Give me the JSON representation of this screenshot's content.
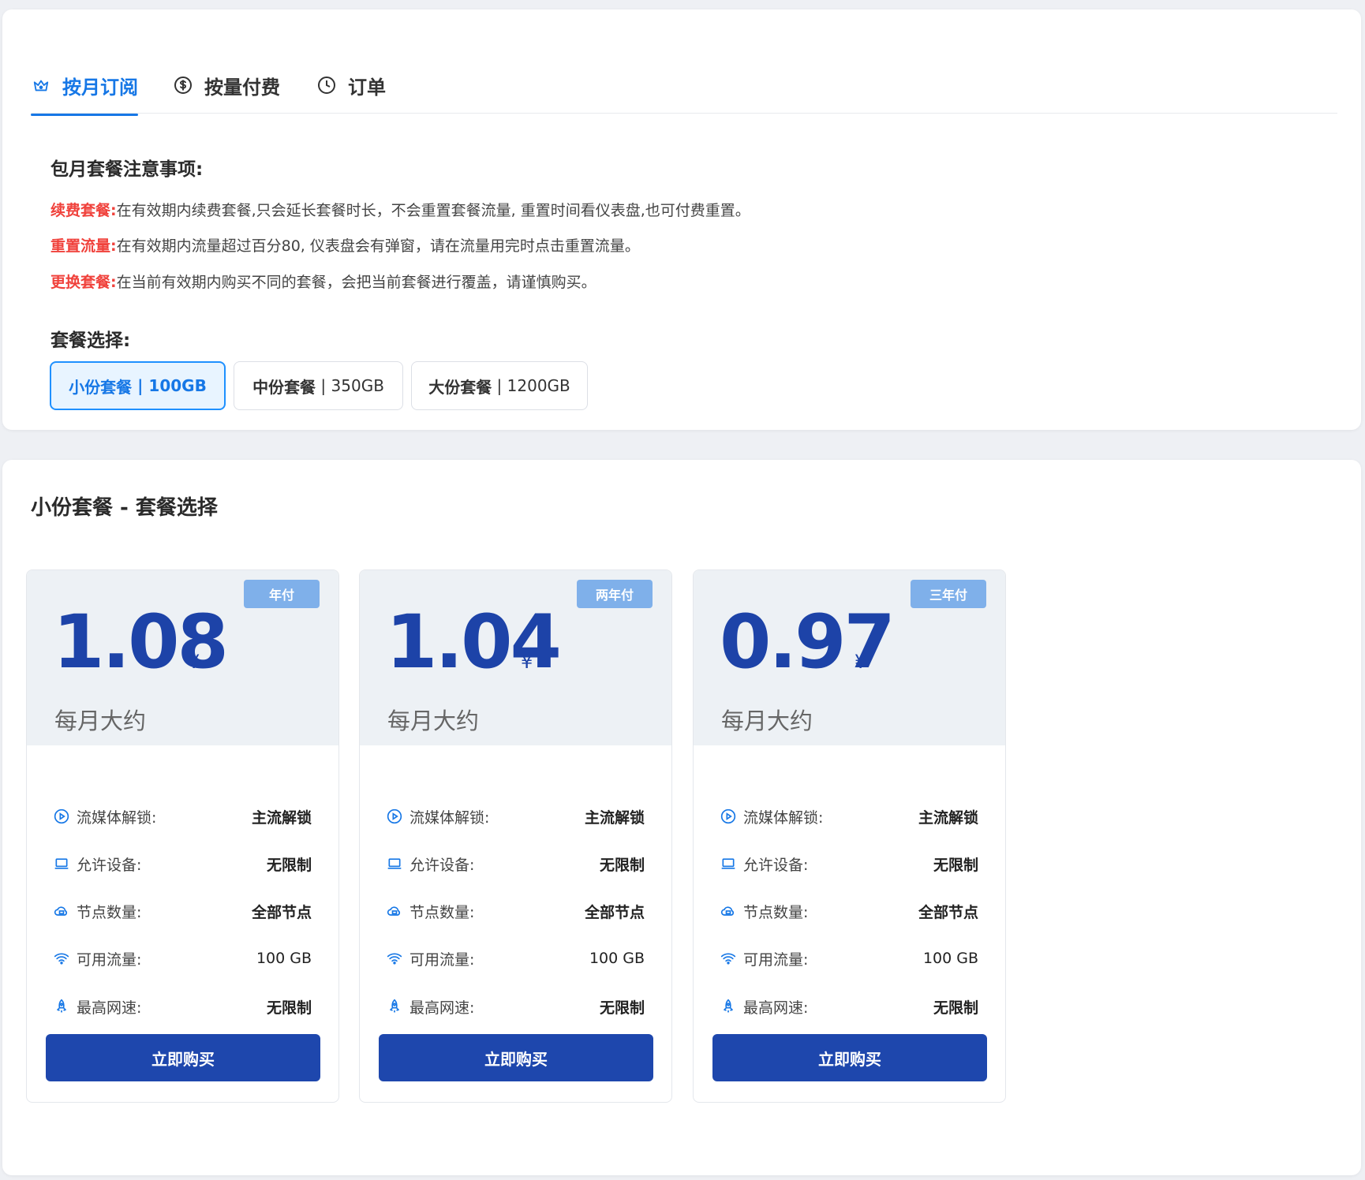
{
  "tabs": [
    {
      "label": "按月订阅",
      "icon": "crown-icon",
      "active": true
    },
    {
      "label": "按量付费",
      "icon": "dollar-coin-icon",
      "active": false
    },
    {
      "label": "订单",
      "icon": "clock-icon",
      "active": false
    }
  ],
  "notice": {
    "title": "包月套餐注意事项:",
    "items": [
      {
        "key": "续费套餐:",
        "text": "在有效期内续费套餐,只会延长套餐时长，不会重置套餐流量, 重置时间看仪表盘,也可付费重置。"
      },
      {
        "key": "重置流量:",
        "text": "在有效期内流量超过百分80, 仪表盘会有弹窗，请在流量用完时点击重置流量。"
      },
      {
        "key": "更换套餐:",
        "text": "在当前有效期内购买不同的套餐，会把当前套餐进行覆盖，请谨慎购买。"
      }
    ]
  },
  "package_select": {
    "title": "套餐选择:",
    "options": [
      {
        "name": "小份套餐",
        "size": "100GB",
        "active": true
      },
      {
        "name": "中份套餐",
        "size": "350GB",
        "active": false
      },
      {
        "name": "大份套餐",
        "size": "1200GB",
        "active": false
      }
    ]
  },
  "section_title": "小份套餐 - 套餐选择",
  "plans": [
    {
      "badge": "年付",
      "price": "1.08",
      "currency": "¥",
      "per": "每月大约",
      "features": [
        {
          "icon": "play-circle-icon",
          "label": "流媒体解锁:",
          "value": "主流解锁"
        },
        {
          "icon": "laptop-icon",
          "label": "允许设备:",
          "value": "无限制"
        },
        {
          "icon": "cloud-server-icon",
          "label": "节点数量:",
          "value": "全部节点"
        },
        {
          "icon": "wifi-icon",
          "label": "可用流量:",
          "value": "100 GB"
        },
        {
          "icon": "rocket-icon",
          "label": "最高网速:",
          "value": "无限制"
        }
      ],
      "button": "立即购买"
    },
    {
      "badge": "两年付",
      "price": "1.04",
      "currency": "¥",
      "per": "每月大约",
      "features": [
        {
          "icon": "play-circle-icon",
          "label": "流媒体解锁:",
          "value": "主流解锁"
        },
        {
          "icon": "laptop-icon",
          "label": "允许设备:",
          "value": "无限制"
        },
        {
          "icon": "cloud-server-icon",
          "label": "节点数量:",
          "value": "全部节点"
        },
        {
          "icon": "wifi-icon",
          "label": "可用流量:",
          "value": "100 GB"
        },
        {
          "icon": "rocket-icon",
          "label": "最高网速:",
          "value": "无限制"
        }
      ],
      "button": "立即购买"
    },
    {
      "badge": "三年付",
      "price": "0.97",
      "currency": "¥",
      "per": "每月大约",
      "features": [
        {
          "icon": "play-circle-icon",
          "label": "流媒体解锁:",
          "value": "主流解锁"
        },
        {
          "icon": "laptop-icon",
          "label": "允许设备:",
          "value": "无限制"
        },
        {
          "icon": "cloud-server-icon",
          "label": "节点数量:",
          "value": "全部节点"
        },
        {
          "icon": "wifi-icon",
          "label": "可用流量:",
          "value": "100 GB"
        },
        {
          "icon": "rocket-icon",
          "label": "最高网速:",
          "value": "无限制"
        }
      ],
      "button": "立即购买"
    }
  ],
  "colors": {
    "accent": "#1677e6",
    "primary_button": "#1e47ad",
    "warning_key": "#f0423c",
    "badge": "#7fb0ea"
  }
}
